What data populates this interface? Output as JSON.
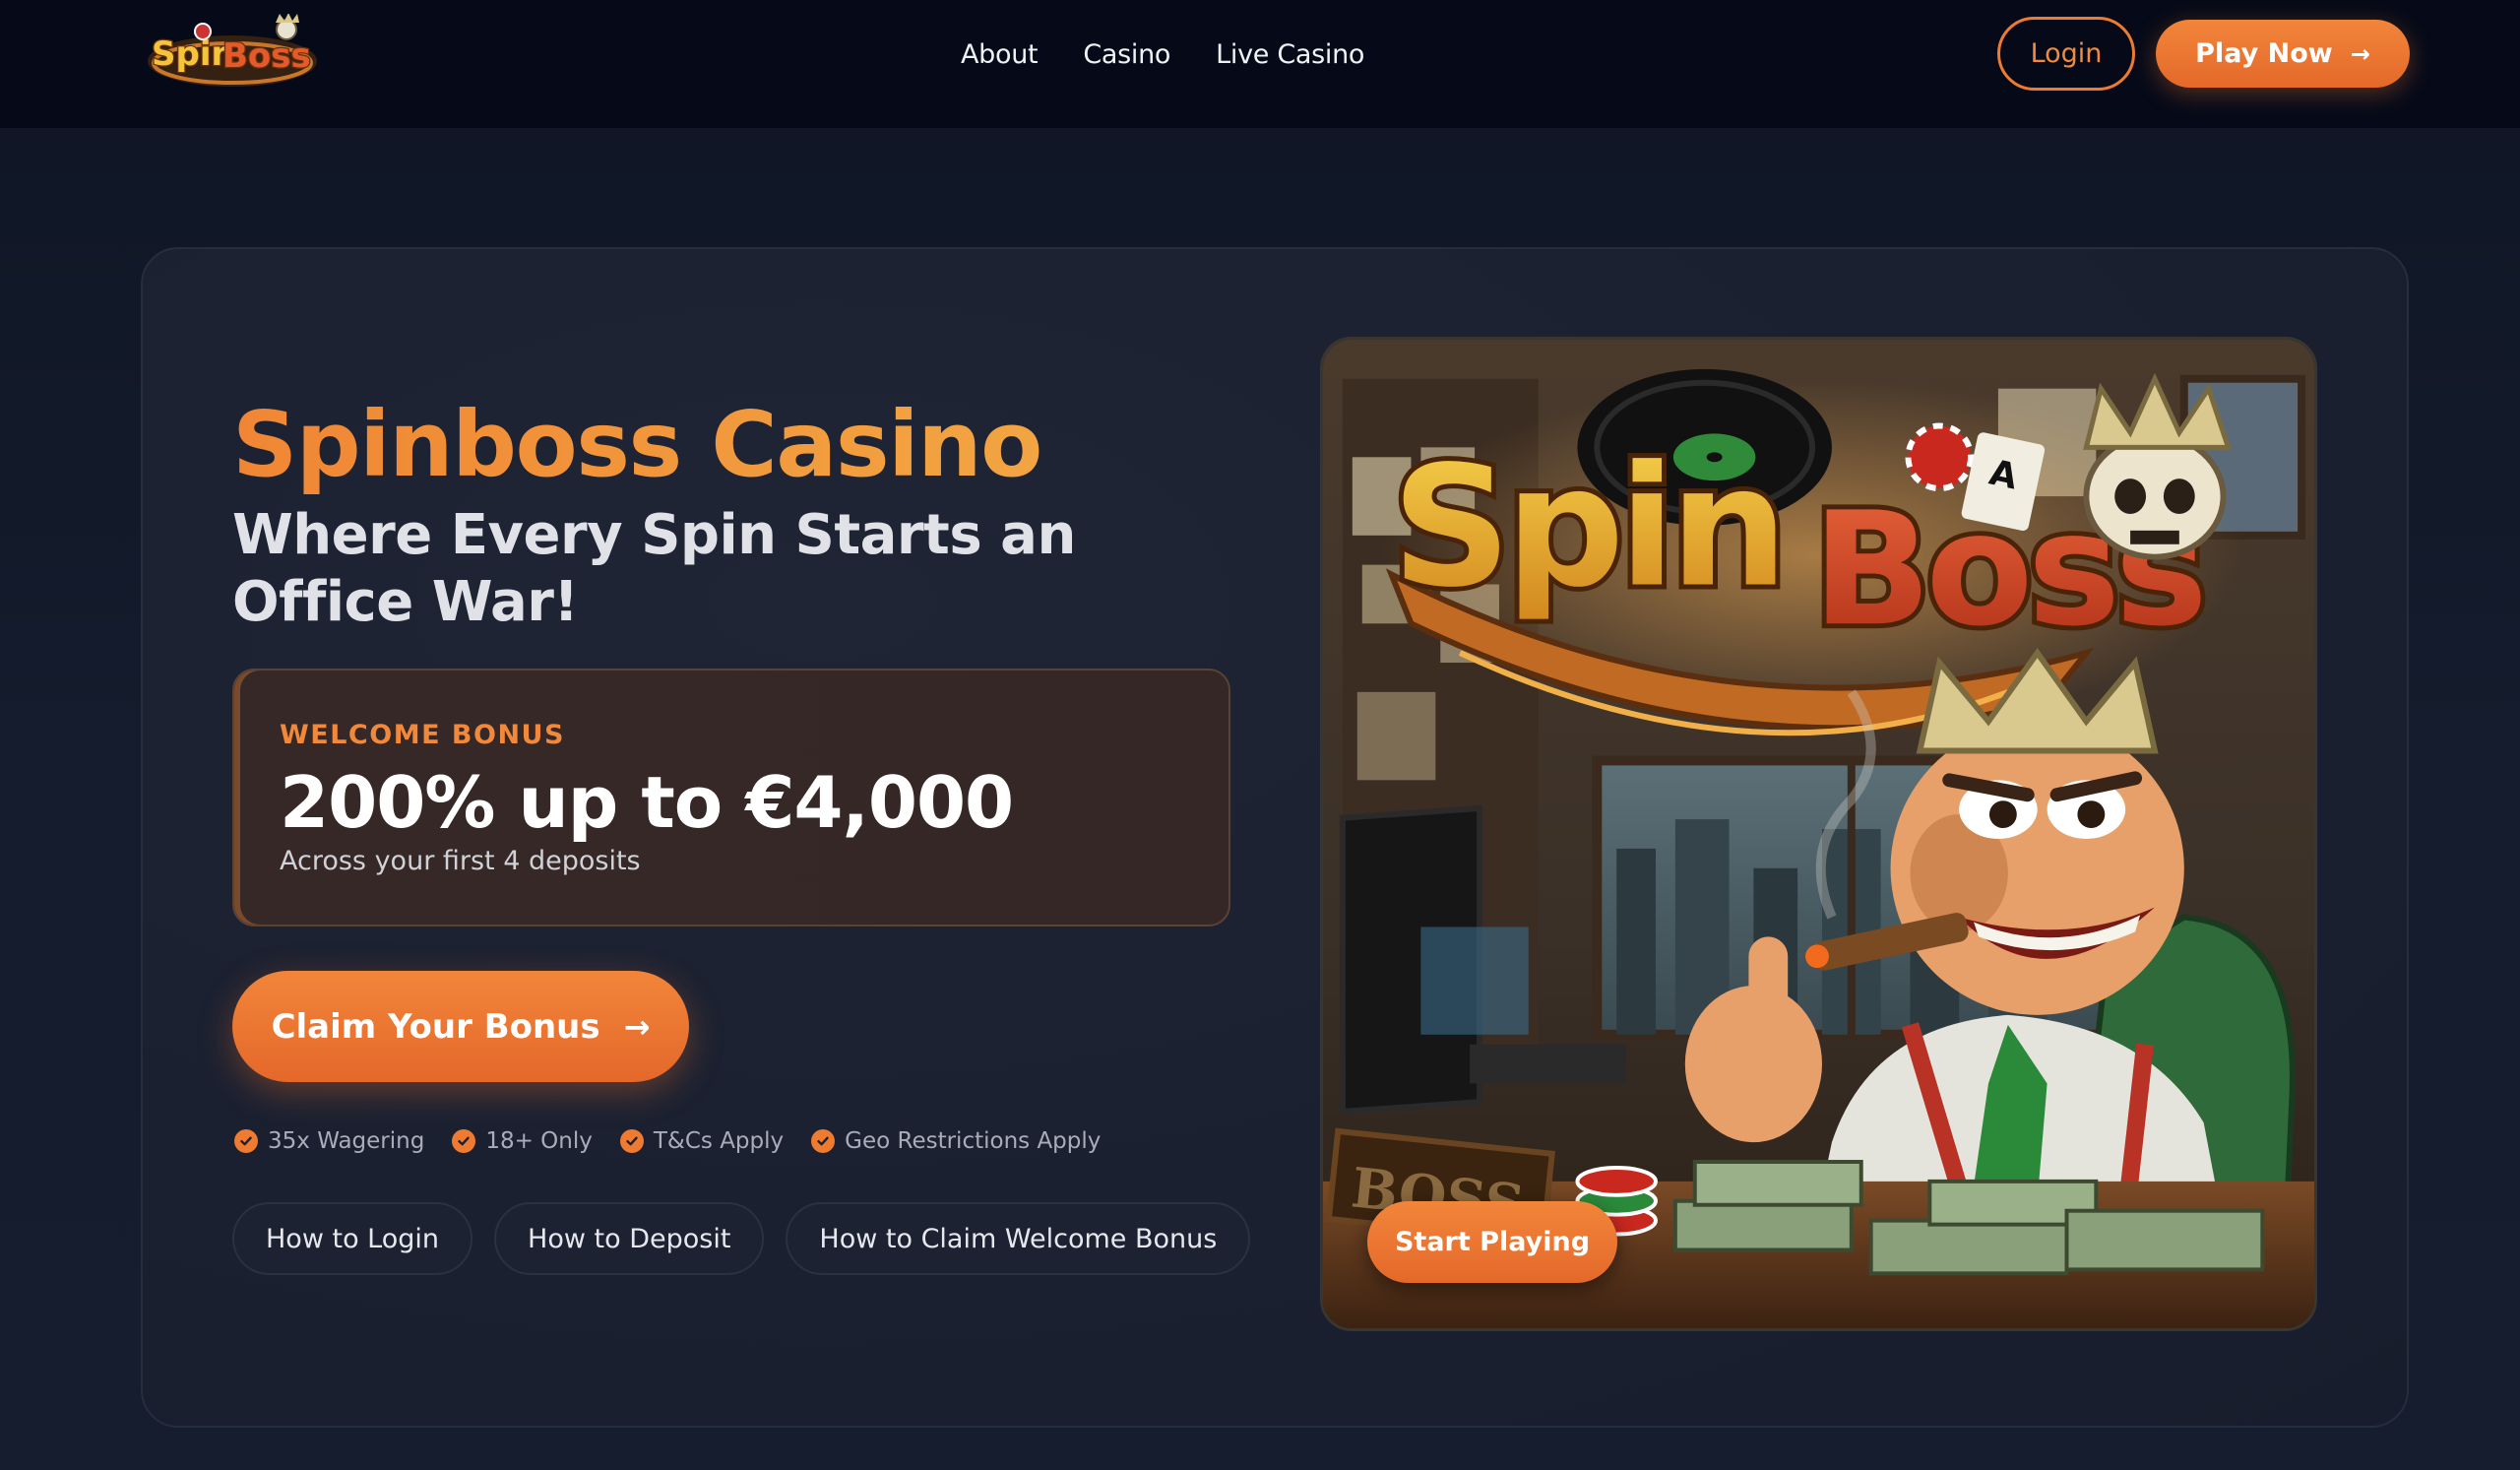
{
  "brand": {
    "logo_text_spin": "Spin",
    "logo_text_boss": "Boss"
  },
  "nav": {
    "items": [
      {
        "label": "About"
      },
      {
        "label": "Casino"
      },
      {
        "label": "Live Casino"
      }
    ]
  },
  "header_actions": {
    "login_label": "Login",
    "play_now_label": "Play Now",
    "arrow_icon": "arrow-right-icon"
  },
  "hero": {
    "title": "Spinboss Casino",
    "subtitle": "Where Every Spin Starts an Office War!",
    "bonus": {
      "label": "WELCOME BONUS",
      "amount": "200% up to €4,000",
      "description": "Across your first 4 deposits"
    },
    "claim_button_label": "Claim Your Bonus",
    "badges": [
      {
        "label": "35x Wagering",
        "icon": "check-circle-icon"
      },
      {
        "label": "18+ Only",
        "icon": "check-circle-icon"
      },
      {
        "label": "T&Cs Apply",
        "icon": "check-circle-icon"
      },
      {
        "label": "Geo Restrictions Apply",
        "icon": "check-circle-icon"
      }
    ],
    "guides": [
      {
        "label": "How to Login"
      },
      {
        "label": "How to Deposit"
      },
      {
        "label": "How to Claim Welcome Bonus"
      }
    ],
    "image": {
      "logo_text_spin": "Spin",
      "logo_text_boss": "Boss",
      "sign_text": "BOSS",
      "start_button_label": "Start Playing"
    }
  },
  "colors": {
    "accent": "#ee7b30",
    "accent_light": "#f2a542",
    "header_bg": "#060a18",
    "page_bg": "#141c2d",
    "card_bg": "#1c2232",
    "bonus_bg": "#362826"
  }
}
